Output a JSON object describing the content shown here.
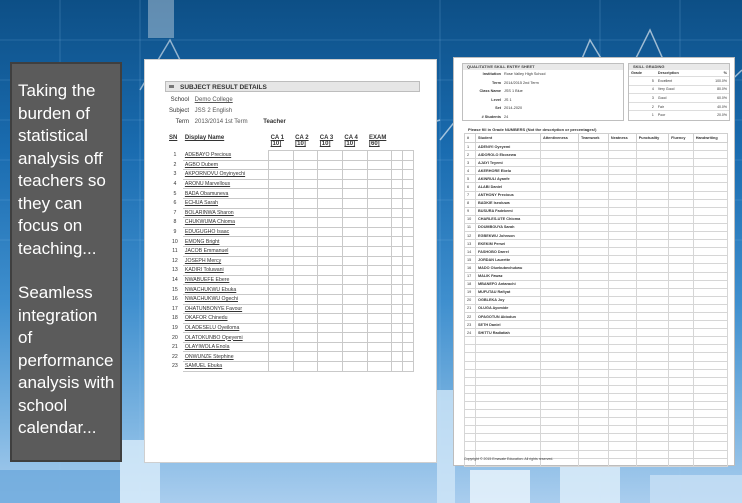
{
  "caption": {
    "line1": "Taking the burden of statistical analysis off teachers so they can focus on teaching...",
    "line2": "Seamless integration of performance analysis with school calendar..."
  },
  "result_details": {
    "title": "SUBJECT RESULT DETAILS",
    "school_label": "School",
    "school_value": "Demo College",
    "subject_label": "Subject",
    "subject_value": "JSS 2 English",
    "term_label": "Term",
    "term_value": "2013/2014 1st Term",
    "teacher_label": "Teacher",
    "columns": {
      "sn": "SN",
      "name": "Display Name",
      "ca1": "CA 1",
      "ca1_max": "[10]",
      "ca2": "CA 2",
      "ca2_max": "[10]",
      "ca3": "CA 3",
      "ca3_max": "[10]",
      "ca4": "CA 4",
      "ca4_max": "[10]",
      "exam": "EXAM",
      "exam_max": "[60]"
    },
    "students": [
      {
        "sn": "1",
        "name": "ADEBAYO Precious"
      },
      {
        "sn": "2",
        "name": "AGBO Dubem"
      },
      {
        "sn": "3",
        "name": "AKPORNOVU Onyinyechi"
      },
      {
        "sn": "4",
        "name": "ARONU Marvellous"
      },
      {
        "sn": "5",
        "name": "BADA Obamuneva"
      },
      {
        "sn": "6",
        "name": "ECHUA Sarah"
      },
      {
        "sn": "7",
        "name": "BOLARINWA Sharon"
      },
      {
        "sn": "8",
        "name": "CHUKWUMA Chioma"
      },
      {
        "sn": "9",
        "name": "EDUGUGHO Isaac"
      },
      {
        "sn": "10",
        "name": "EMONG Bright"
      },
      {
        "sn": "11",
        "name": "JACOB Emmanuel"
      },
      {
        "sn": "12",
        "name": "JOSEPH Mercy"
      },
      {
        "sn": "13",
        "name": "KADIRI Toluwani"
      },
      {
        "sn": "14",
        "name": "NWABUEFE Ebere"
      },
      {
        "sn": "15",
        "name": "NWACHUKWU Ebuka"
      },
      {
        "sn": "16",
        "name": "NWACHUKWU Ogechi"
      },
      {
        "sn": "17",
        "name": "OHATUNBONYE Favour"
      },
      {
        "sn": "18",
        "name": "OKAFOR Chinedu"
      },
      {
        "sn": "19",
        "name": "OLADESELU Oyeiloma"
      },
      {
        "sn": "20",
        "name": "OLATOKUNBO Opeyemi"
      },
      {
        "sn": "21",
        "name": "OLAYIWOLA Enola"
      },
      {
        "sn": "22",
        "name": "ONWUNZE Stephine"
      },
      {
        "sn": "23",
        "name": "SAMUEL Ebuka"
      }
    ]
  },
  "skill_sheet": {
    "title": "QUALITATIVE SKILL ENTRY SHEET",
    "info": [
      {
        "label": "Institution",
        "value": "Rose Valley High School"
      },
      {
        "label": "Term",
        "value": "2014/2015 2nd Term"
      },
      {
        "label": "Class Name",
        "value": "JSS 1 Blue"
      },
      {
        "label": "Level",
        "value": "JS 1"
      },
      {
        "label": "Set",
        "value": "2014-2020"
      },
      {
        "label": "# Students",
        "value": "24"
      }
    ],
    "grading": {
      "title": "SKILL GRADING",
      "headers": [
        "Grade",
        "Description",
        "%"
      ],
      "rows": [
        {
          "grade": "5",
          "desc": "Excellent",
          "pct": "100.0%"
        },
        {
          "grade": "4",
          "desc": "Very Good",
          "pct": "80.0%"
        },
        {
          "grade": "3",
          "desc": "Good",
          "pct": "60.0%"
        },
        {
          "grade": "2",
          "desc": "Fair",
          "pct": "40.0%"
        },
        {
          "grade": "1",
          "desc": "Poor",
          "pct": "20.0%"
        }
      ]
    },
    "fill_note": "Please fill in Grade NUMBERS (Not the description or percentages!)",
    "columns": [
      "#",
      "Student",
      "Attentiveness",
      "Teamwork",
      "Neatness",
      "Punctuality",
      "Fluency",
      "Handwriting"
    ],
    "students": [
      {
        "no": "1",
        "name": "ADENIYI Oyeyemi"
      },
      {
        "no": "2",
        "name": "AIDOROLO Ebosewa"
      },
      {
        "no": "3",
        "name": "AJAYI Teyemi"
      },
      {
        "no": "4",
        "name": "AKERHORE Ebelu"
      },
      {
        "no": "5",
        "name": "AKINRULI Ayanfe"
      },
      {
        "no": "6",
        "name": "ALABI Daniel"
      },
      {
        "no": "7",
        "name": "ANTHONY Precious"
      },
      {
        "no": "8",
        "name": "BADKIE Iseoluwa"
      },
      {
        "no": "9",
        "name": "BUSURA Fadekemi"
      },
      {
        "no": "10",
        "name": "CHARLES-UTE Chioma"
      },
      {
        "no": "11",
        "name": "DOUMBOUYA Sarah"
      },
      {
        "no": "12",
        "name": "EGBEKWU Johnson"
      },
      {
        "no": "13",
        "name": "EKEKIM Persei"
      },
      {
        "no": "14",
        "name": "FASHOBO Darrel"
      },
      {
        "no": "15",
        "name": "JORDAN Laurette"
      },
      {
        "no": "16",
        "name": "MADO Oluebubechukwu"
      },
      {
        "no": "17",
        "name": "MALIK Fawaz"
      },
      {
        "no": "18",
        "name": "MBANEFO Antarachi"
      },
      {
        "no": "19",
        "name": "MUFUTAU Rafiyat"
      },
      {
        "no": "20",
        "name": "OGBLEKA Joy"
      },
      {
        "no": "21",
        "name": "OLUGA Ayomide"
      },
      {
        "no": "22",
        "name": "OPAGOTUN Abiodun"
      },
      {
        "no": "23",
        "name": "SETH Daniel"
      },
      {
        "no": "24",
        "name": "SHITTU Radiatiah"
      }
    ],
    "copyright": "Copyright © 2015 Emavate Education. All rights reserved."
  }
}
